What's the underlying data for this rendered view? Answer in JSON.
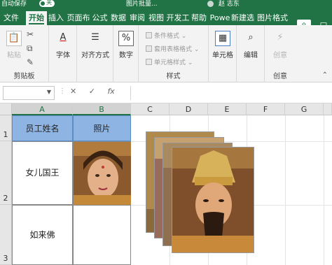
{
  "titlebar": {
    "autosave": "自动保存",
    "toggle_state": "关",
    "filename": "图片批量...",
    "user": "赵 志东"
  },
  "tabs": [
    {
      "label": "文件"
    },
    {
      "label": "开始"
    },
    {
      "label": "插入"
    },
    {
      "label": "页面布"
    },
    {
      "label": "公式"
    },
    {
      "label": "数据"
    },
    {
      "label": "审阅"
    },
    {
      "label": "视图"
    },
    {
      "label": "开发工"
    },
    {
      "label": "帮助"
    },
    {
      "label": "Powe"
    },
    {
      "label": "新建选"
    },
    {
      "label": "图片格式"
    }
  ],
  "ribbon": {
    "clipboard": {
      "paste": "粘贴",
      "group": "剪贴板"
    },
    "font": {
      "label": "字体"
    },
    "align": {
      "label": "对齐方式"
    },
    "number": {
      "label": "数字"
    },
    "styles": {
      "cond": "条件格式",
      "table": "套用表格格式",
      "cell": "单元格样式",
      "group": "样式"
    },
    "cells": {
      "label": "单元格"
    },
    "editing": {
      "label": "编辑"
    },
    "creative": {
      "label": "创意",
      "group": "创意"
    }
  },
  "formula_bar": {
    "cancel_icon": "✕",
    "confirm_icon": "✓",
    "fx": "fx"
  },
  "sheet": {
    "columns": [
      "A",
      "B",
      "C",
      "D",
      "E",
      "F",
      "G"
    ],
    "rows": [
      "1",
      "2",
      "3"
    ],
    "header_row": {
      "a": "员工姓名",
      "b": "照片"
    },
    "row2": {
      "a": "女儿国王"
    },
    "row3": {
      "a": "如来佛"
    }
  }
}
